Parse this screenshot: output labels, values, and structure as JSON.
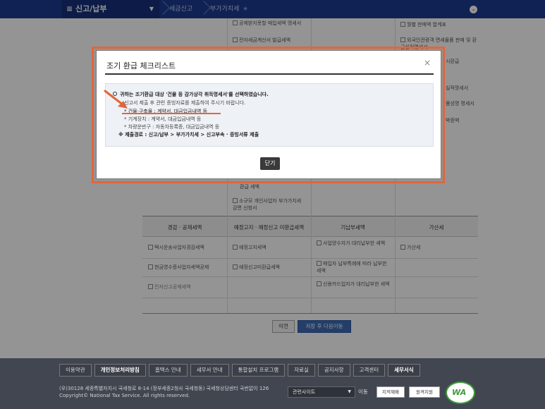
{
  "topnav": {
    "menu_label": "신고/납부",
    "breadcrumb": [
      "세금신고",
      "부가가치세"
    ]
  },
  "background": {
    "col1_items": [
      "공제받지못할 매입세액 명세서",
      "전자세금계산서 발급세액"
    ],
    "col3_items": [
      "월별 판매액 합계표",
      "외국인관광객 면세물품 판매 및 환급실적명세서",
      "시환급",
      "실적명세서",
      "품성명 명세서",
      "박증액"
    ],
    "mid_items": [
      "환급 세액",
      "소규모 개인사업자 부가가치세 감면 신청서"
    ],
    "table_headers": [
      "경감 · 공제세액",
      "예정고지 · 예정신고 미환급세액",
      "기납부세액",
      "가산세"
    ],
    "rows": [
      [
        "택시운송사업자경감세액",
        "예정고지세액",
        "사업양수자가 대리납부한 세액",
        "가산세"
      ],
      [
        "현금영수증사업자세액공제",
        "예정신고미환급세액",
        "매입자 납부특례에 따라 납부한 세액",
        ""
      ],
      [
        "전자신고공제세액",
        "",
        "신용카드업자가 대리납부한 세액",
        ""
      ]
    ],
    "prev_button": "이전",
    "next_button": "저장 후 다음이동"
  },
  "modal": {
    "title": "조기 환급 체크리스트",
    "close_symbol": "×",
    "line1": "귀하는 조기환급 대상 '건물 등 감가상각 취득명세서'를 선택하였습니다.",
    "line2": "신고서 제출 후 관련 증빙자료를 제출하여 주시기 바랍니다.",
    "line3": "* 건물·구축물 : 계약서, 대금입금내역 등",
    "line4": "* 기계장치 : 계약서, 대금입금내역 등",
    "line5": "* 차량운반구 : 자동차등록증, 대금입금내역 등",
    "line6": "※ 제출경로 : 신고/납부 > 부가가치세 > 신고부속 · 증빙서류 제출",
    "close_button": "닫기"
  },
  "footer": {
    "links": [
      "이용약관",
      "개인정보처리방침",
      "홈택스 안내",
      "세무서 안내",
      "통합설치 프로그램",
      "자료실",
      "공지사항",
      "고객센터",
      "세무서식"
    ],
    "address": "(우)30128 세종특별자치시 국세청로 8-14 (정부세종2청사 국세청동) 국세청상담센터 국번없이 126",
    "copyright": "Copyright© National Tax Service. All rights reserved.",
    "related_sites": "관련사이트",
    "go_label": "이동",
    "btn1": "지적재배",
    "btn2": "원격지원",
    "logo_text": "WA"
  },
  "colors": {
    "nav": "#1d3a8f",
    "highlight": "#e2663b",
    "footer": "#414651"
  }
}
